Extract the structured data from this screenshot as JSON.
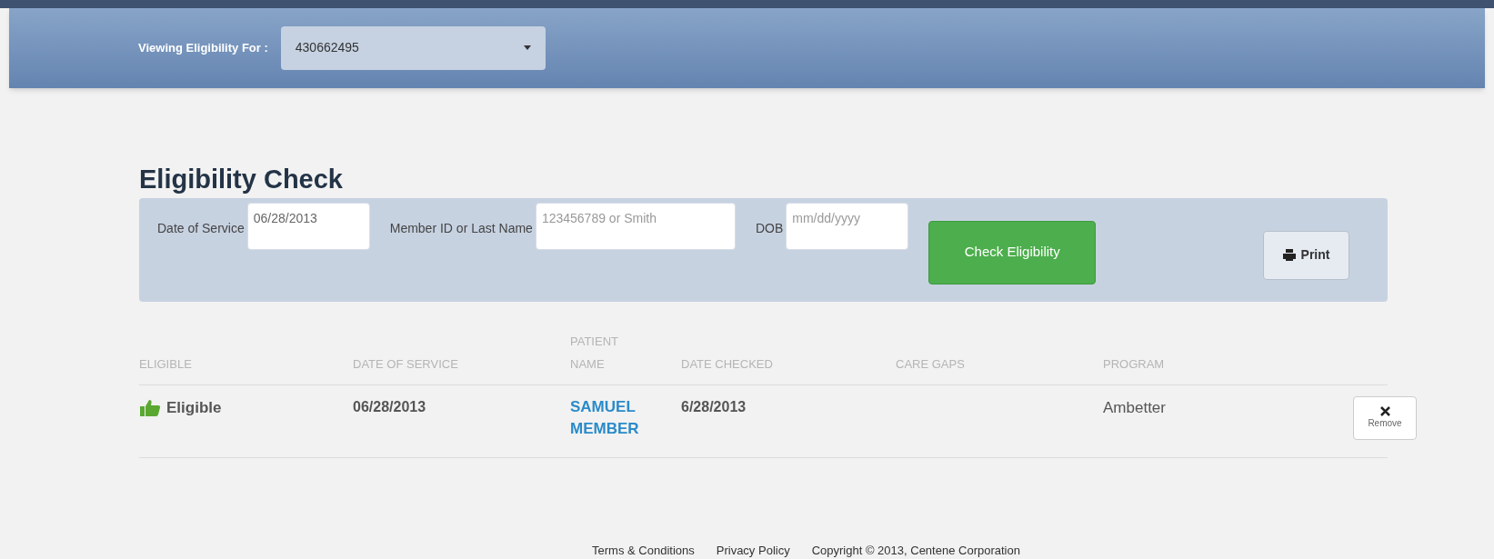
{
  "header": {
    "label": "Viewing Eligibility For :",
    "selector": {
      "value": "430662495"
    }
  },
  "title": "Eligibility Check",
  "form": {
    "fields": [
      {
        "label": "Date of Service",
        "value": "06/28/2013"
      },
      {
        "label": "Member ID or Last Name",
        "placeholder": "123456789 or Smith"
      },
      {
        "label": "DOB",
        "placeholder": "mm/dd/yyyy"
      }
    ],
    "submit": "Check Eligibility",
    "print": "Print"
  },
  "table": {
    "columns": [
      "ELIGIBLE",
      "DATE OF SERVICE",
      "PATIENT NAME",
      "DATE CHECKED",
      "CARE GAPS",
      "PROGRAM"
    ],
    "rows": [
      {
        "eligible": true,
        "status": "Eligible",
        "date_of_service": "06/28/2013",
        "patient_name": "SAMUEL MEMBER",
        "date_checked": "6/28/2013",
        "care_gaps": "",
        "program": "Ambetter",
        "action": "Remove"
      }
    ]
  },
  "footer": {
    "links": [
      "Terms & Conditions",
      "Privacy Policy"
    ],
    "copyright": "Copyright © 2013, Centene Corporation"
  }
}
